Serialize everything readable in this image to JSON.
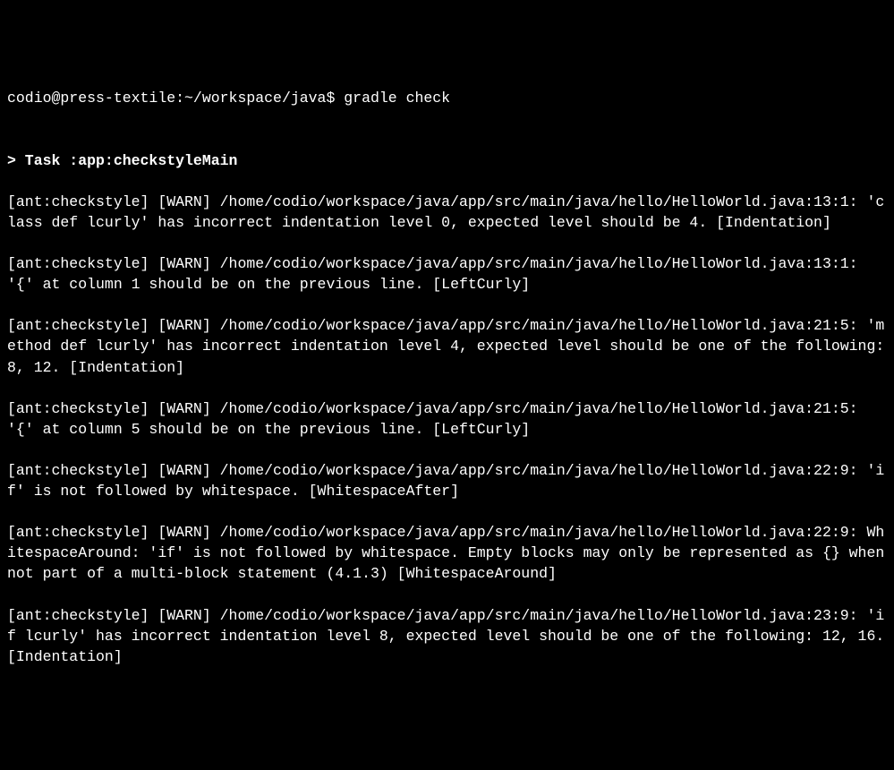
{
  "prompt": "codio@press-textile:~/workspace/java$ gradle check",
  "task_header": "> Task :app:checkstyleMain",
  "log_lines": [
    "[ant:checkstyle] [WARN] /home/codio/workspace/java/app/src/main/java/hello/HelloWorld.java:13:1: 'class def lcurly' has incorrect indentation level 0, expected level should be 4. [Indentation]",
    "[ant:checkstyle] [WARN] /home/codio/workspace/java/app/src/main/java/hello/HelloWorld.java:13:1: '{' at column 1 should be on the previous line. [LeftCurly]",
    "[ant:checkstyle] [WARN] /home/codio/workspace/java/app/src/main/java/hello/HelloWorld.java:21:5: 'method def lcurly' has incorrect indentation level 4, expected level should be one of the following: 8, 12. [Indentation]",
    "[ant:checkstyle] [WARN] /home/codio/workspace/java/app/src/main/java/hello/HelloWorld.java:21:5: '{' at column 5 should be on the previous line. [LeftCurly]",
    "[ant:checkstyle] [WARN] /home/codio/workspace/java/app/src/main/java/hello/HelloWorld.java:22:9: 'if' is not followed by whitespace. [WhitespaceAfter]",
    "[ant:checkstyle] [WARN] /home/codio/workspace/java/app/src/main/java/hello/HelloWorld.java:22:9: WhitespaceAround: 'if' is not followed by whitespace. Empty blocks may only be represented as {} when not part of a multi-block statement (4.1.3) [WhitespaceAround]",
    "[ant:checkstyle] [WARN] /home/codio/workspace/java/app/src/main/java/hello/HelloWorld.java:23:9: 'if lcurly' has incorrect indentation level 8, expected level should be one of the following: 12, 16. [Indentation]"
  ]
}
